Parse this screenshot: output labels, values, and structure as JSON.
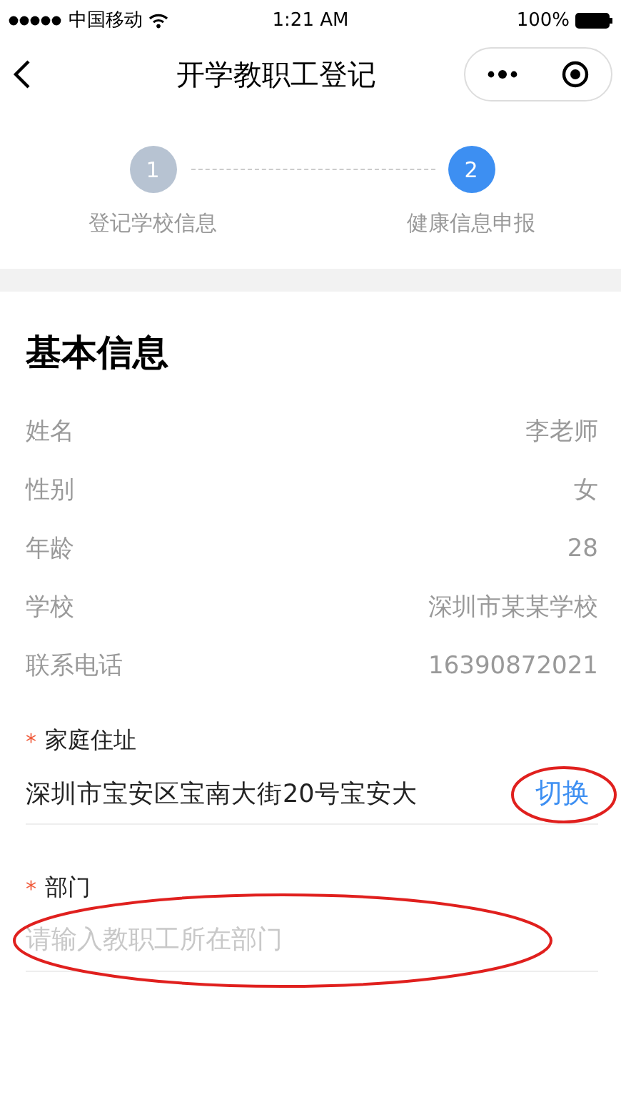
{
  "status_bar": {
    "carrier": "中国移动",
    "time": "1:21 AM",
    "battery": "100%"
  },
  "nav": {
    "title": "开学教职工登记"
  },
  "steps": [
    {
      "number": "1",
      "label": "登记学校信息",
      "selected": false
    },
    {
      "number": "2",
      "label": "健康信息申报",
      "selected": true
    }
  ],
  "section": {
    "title": "基本信息"
  },
  "info_rows": [
    {
      "label": "姓名",
      "value": "李老师"
    },
    {
      "label": "性别",
      "value": "女"
    },
    {
      "label": "年龄",
      "value": "28"
    },
    {
      "label": "学校",
      "value": "深圳市某某学校"
    },
    {
      "label": "联系电话",
      "value": "16390872021"
    }
  ],
  "fields": [
    {
      "kind": "address",
      "required_mark": "*",
      "label": "家庭住址",
      "value": "深圳市宝安区宝南大街20号宝安大",
      "action": "切换",
      "circled": true
    },
    {
      "kind": "input",
      "required_mark": "*",
      "label": "部门",
      "placeholder": "请输入教职工所在部门",
      "circled": true
    }
  ]
}
